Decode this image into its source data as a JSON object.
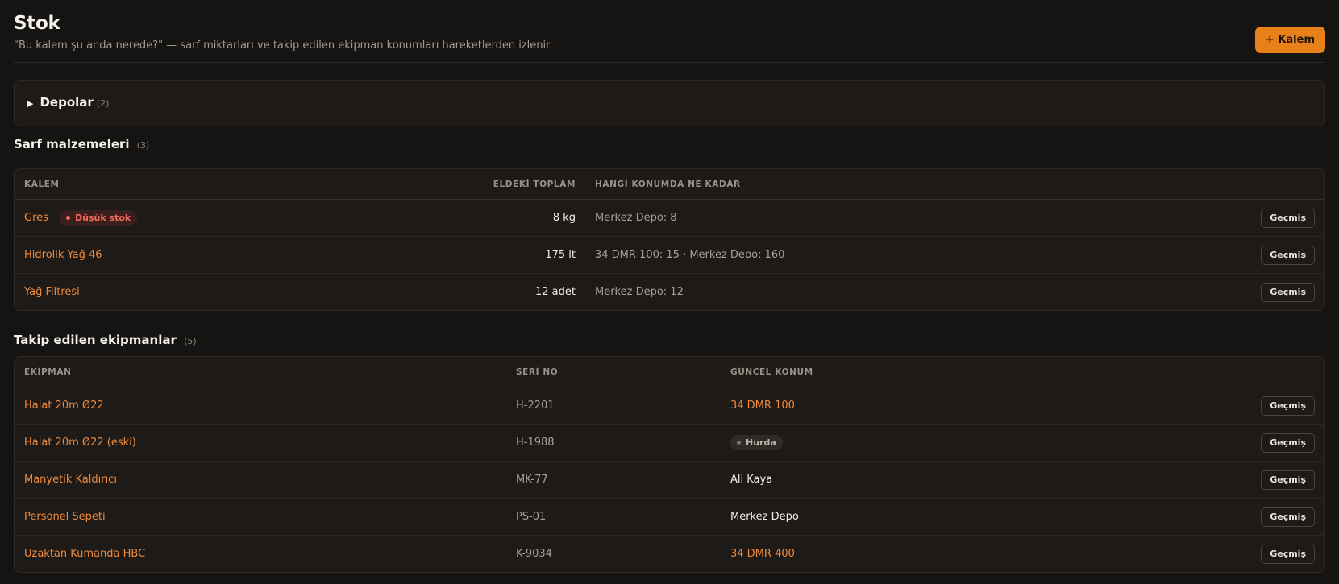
{
  "header": {
    "title": "Stok",
    "subtitle": "\"Bu kalem şu anda nerede?\" — sarf miktarları ve takip edilen ekipman konumları hareketlerden izlenir",
    "add_button": "+ Kalem"
  },
  "depots": {
    "label": "Depolar",
    "count": "(2)"
  },
  "consumables": {
    "title": "Sarf malzemeleri",
    "count": "(3)",
    "columns": [
      "KALEM",
      "ELDEKİ TOPLAM",
      "HANGİ KONUMDA NE KADAR"
    ],
    "rows": [
      {
        "name": "Gres",
        "badge": "Düşük stok",
        "total": "8 kg",
        "locations": "Merkez Depo: 8",
        "action": "Geçmiş"
      },
      {
        "name": "Hidrolik Yağ 46",
        "total": "175 lt",
        "locations": "34 DMR 100: 15 · Merkez Depo: 160",
        "action": "Geçmiş"
      },
      {
        "name": "Yağ Filtresi",
        "total": "12 adet",
        "locations": "Merkez Depo: 12",
        "action": "Geçmiş"
      }
    ]
  },
  "equipment": {
    "title": "Takip edilen ekipmanlar",
    "count": "(5)",
    "columns": [
      "EKİPMAN",
      "SERİ NO",
      "GÜNCEL KONUM"
    ],
    "rows": [
      {
        "name": "Halat 20m Ø22",
        "serial": "H-2201",
        "location": "34 DMR 100",
        "action": "Geçmiş"
      },
      {
        "name": "Halat 20m Ø22 (eski)",
        "serial": "H-1988",
        "location": "Hurda",
        "action": "Geçmiş"
      },
      {
        "name": "Manyetik Kaldırıcı",
        "serial": "MK-77",
        "location": "Ali Kaya",
        "action": "Geçmiş"
      },
      {
        "name": "Personel Sepeti",
        "serial": "PS-01",
        "location": "Merkez Depo",
        "action": "Geçmiş"
      },
      {
        "name": "Uzaktan Kumanda HBC",
        "serial": "K-9034",
        "location": "34 DMR 400",
        "action": "Geçmiş"
      }
    ]
  },
  "colors": {
    "accent": "#e8801a",
    "link": "#ef8a3c",
    "danger": "#f06a5a",
    "background": "#161412"
  }
}
